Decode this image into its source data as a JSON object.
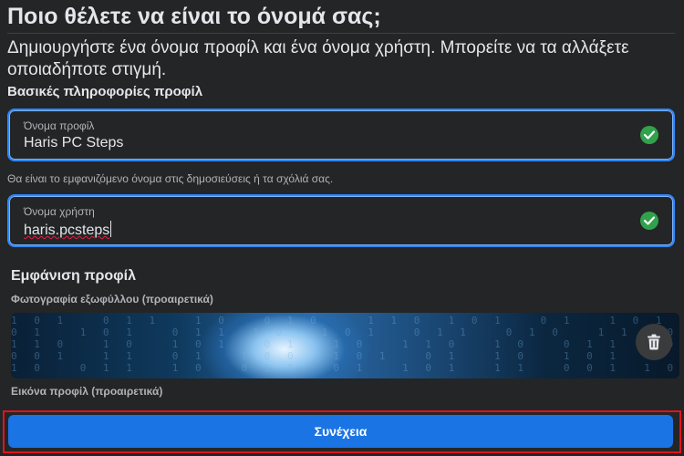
{
  "header": {
    "title": "Ποιο θέλετε να είναι το όνομά σας;",
    "subtitle": "Δημιουργήστε ένα όνομα προφίλ και ένα όνομα χρήστη. Μπορείτε να τα αλλάξετε οποιαδήποτε στιγμή."
  },
  "basic_info": {
    "section_title": "Βασικές πληροφορίες προφίλ",
    "profile_name": {
      "label": "Όνομα προφίλ",
      "value": "Haris PC Steps",
      "valid_icon": "check-circle-icon"
    },
    "helper_text": "Θα είναι το εμφανιζόμενο όνομα στις δημοσιεύσεις ή τα σχόλιά σας.",
    "username": {
      "label": "Όνομα χρήστη",
      "value": "haris.pcsteps",
      "valid_icon": "check-circle-icon"
    }
  },
  "appearance": {
    "section_title": "Εμφάνιση προφίλ",
    "cover_label": "Φωτογραφία εξωφύλλου (προαιρετικά)",
    "delete_icon": "trash-icon",
    "avatar_label": "Εικόνα προφίλ (προαιρετικά)"
  },
  "footer": {
    "continue_label": "Συνέχεια",
    "highlight_color": "#e0141e"
  },
  "colors": {
    "accent": "#1b74e4",
    "success": "#31a24c",
    "background": "#242526"
  }
}
